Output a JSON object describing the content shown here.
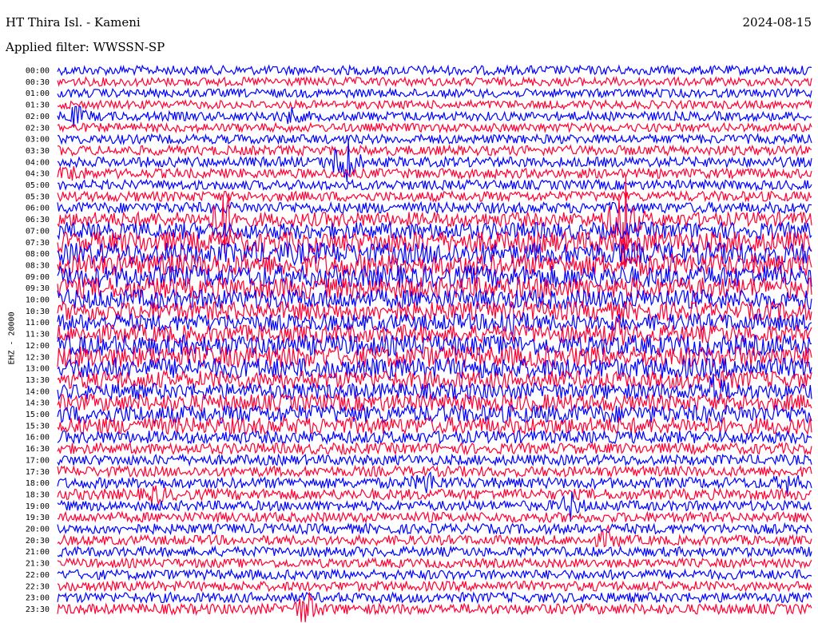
{
  "header": {
    "station": "HT Thira Isl. - Kameni",
    "date": "2024-08-15",
    "filter": "Applied filter: WWSSN-SP"
  },
  "channel_label": "EHZ - 20000",
  "colors": {
    "line_a": "#0000ff",
    "line_b": "#ff0033"
  },
  "chart_data": {
    "type": "line",
    "title": "HT Thira Isl. - Kameni",
    "subtitle": "Applied filter: WWSSN-SP",
    "ylabel": "EHZ - 20000",
    "xlabel": "",
    "row_labels": [
      "00:00",
      "00:30",
      "01:00",
      "01:30",
      "02:00",
      "02:30",
      "03:00",
      "03:30",
      "04:00",
      "04:30",
      "05:00",
      "05:30",
      "06:00",
      "06:30",
      "07:00",
      "07:30",
      "08:00",
      "08:30",
      "09:00",
      "09:30",
      "10:00",
      "10:30",
      "11:00",
      "11:30",
      "12:00",
      "12:30",
      "13:00",
      "13:30",
      "14:00",
      "14:30",
      "15:00",
      "15:30",
      "16:00",
      "16:30",
      "17:00",
      "17:30",
      "18:00",
      "18:30",
      "19:00",
      "19:30",
      "20:00",
      "20:30",
      "21:00",
      "21:30",
      "22:00",
      "22:30",
      "23:00",
      "23:30"
    ],
    "row_noise_level": [
      0.25,
      0.22,
      0.22,
      0.2,
      0.25,
      0.22,
      0.25,
      0.28,
      0.3,
      0.28,
      0.28,
      0.3,
      0.35,
      0.55,
      0.7,
      0.95,
      1.0,
      1.0,
      1.0,
      0.95,
      0.85,
      0.8,
      0.7,
      0.75,
      0.9,
      0.95,
      0.9,
      0.75,
      0.65,
      0.7,
      0.75,
      0.7,
      0.45,
      0.35,
      0.32,
      0.32,
      0.35,
      0.35,
      0.3,
      0.3,
      0.3,
      0.28,
      0.28,
      0.25,
      0.28,
      0.28,
      0.3,
      0.32
    ],
    "events": [
      {
        "row": 4,
        "pos": 0.025,
        "amp": 1.2
      },
      {
        "row": 4,
        "pos": 0.31,
        "amp": 0.8
      },
      {
        "row": 8,
        "pos": 0.38,
        "amp": 5.0
      },
      {
        "row": 9,
        "pos": 0.02,
        "amp": 1.0
      },
      {
        "row": 13,
        "pos": 0.22,
        "amp": 4.5
      },
      {
        "row": 13,
        "pos": 0.75,
        "amp": 8.0
      },
      {
        "row": 22,
        "pos": 0.6,
        "amp": 2.2
      },
      {
        "row": 23,
        "pos": 0.74,
        "amp": 1.2
      },
      {
        "row": 28,
        "pos": 0.87,
        "amp": 2.0
      },
      {
        "row": 36,
        "pos": 0.49,
        "amp": 1.5
      },
      {
        "row": 36,
        "pos": 0.97,
        "amp": 1.2
      },
      {
        "row": 37,
        "pos": 0.13,
        "amp": 1.0
      },
      {
        "row": 38,
        "pos": 0.68,
        "amp": 1.6
      },
      {
        "row": 41,
        "pos": 0.73,
        "amp": 1.3
      },
      {
        "row": 47,
        "pos": 0.33,
        "amp": 2.5
      }
    ]
  }
}
